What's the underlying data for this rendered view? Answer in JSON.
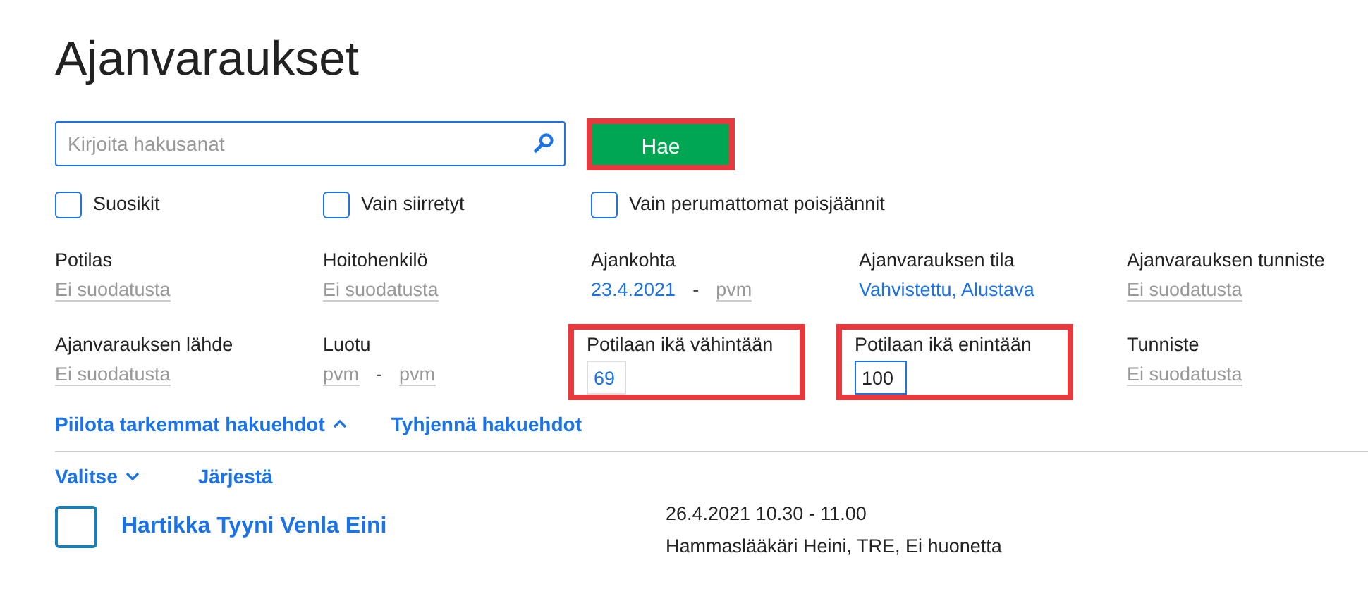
{
  "title": "Ajanvaraukset",
  "search": {
    "placeholder": "Kirjoita hakusanat"
  },
  "search_button": {
    "label": "Hae",
    "highlighted": true
  },
  "checkboxes": [
    {
      "label": "Suosikit",
      "checked": false
    },
    {
      "label": "Vain siirretyt",
      "checked": false
    },
    {
      "label": "Vain perumattomat poisjäännit",
      "checked": false
    }
  ],
  "filters": [
    {
      "kind": "select",
      "label": "Potilas",
      "value": "Ei suodatusta",
      "set": false
    },
    {
      "kind": "select",
      "label": "Hoitohenkilö",
      "value": "Ei suodatusta",
      "set": false
    },
    {
      "kind": "range",
      "label": "Ajankohta",
      "from": {
        "text": "23.4.2021",
        "set": true
      },
      "separator": "-",
      "to": {
        "text": "pvm",
        "set": false
      }
    },
    {
      "kind": "select",
      "label": "Ajanvarauksen tila",
      "value": "Vahvistettu, Alustava",
      "set": true
    },
    {
      "kind": "select",
      "label": "Ajanvarauksen tunniste",
      "value": "Ei suodatusta",
      "set": false
    },
    {
      "kind": "select",
      "label": "Ajanvarauksen lähde",
      "value": "Ei suodatusta",
      "set": false
    },
    {
      "kind": "range",
      "label": "Luotu",
      "from": {
        "text": "pvm",
        "set": false
      },
      "separator": "-",
      "to": {
        "text": "pvm",
        "set": false
      }
    },
    {
      "kind": "input",
      "label": "Potilaan ikä vähintään",
      "value": "69",
      "focused": false,
      "highlighted": true
    },
    {
      "kind": "input",
      "label": "Potilaan ikä enintään",
      "value": "100",
      "focused": true,
      "highlighted": true
    },
    {
      "kind": "select",
      "label": "Tunniste",
      "value": "Ei suodatusta",
      "set": false
    }
  ],
  "links": [
    {
      "label": "Piilota tarkemmat hakuehdot",
      "expanded": true
    },
    {
      "label": "Tyhjennä hakuehdot"
    }
  ],
  "toolbar": [
    {
      "label": "Valitse",
      "dropdown": true
    },
    {
      "label": "Järjestä"
    }
  ],
  "results": [
    {
      "name": "Hartikka Tyyni Venla Eini",
      "checked": false,
      "time": "26.4.2021 10.30 - 11.00",
      "details": "Hammaslääkäri Heini, TRE, Ei huonetta"
    }
  ]
}
